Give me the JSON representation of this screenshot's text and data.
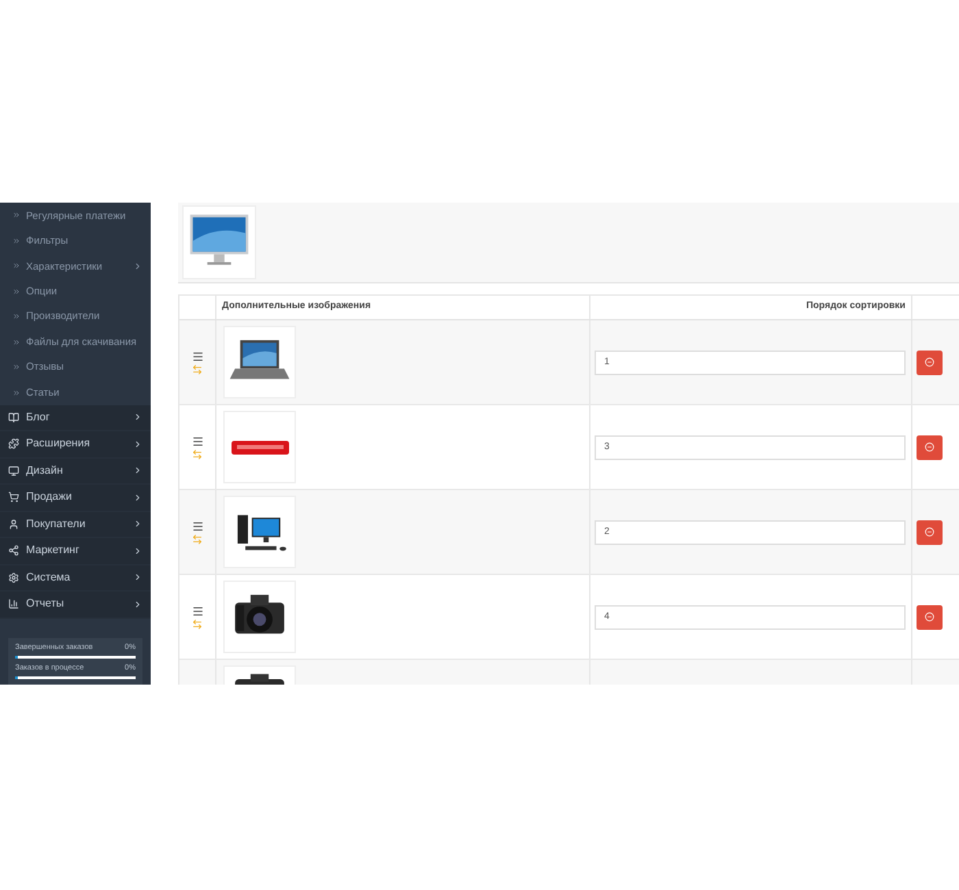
{
  "sidebar": {
    "sub_items": [
      {
        "label": "Регулярные платежи",
        "has_children": false
      },
      {
        "label": "Фильтры",
        "has_children": false
      },
      {
        "label": "Характеристики",
        "has_children": true
      },
      {
        "label": "Опции",
        "has_children": false
      },
      {
        "label": "Производители",
        "has_children": false
      },
      {
        "label": "Файлы для скачивания",
        "has_children": false
      },
      {
        "label": "Отзывы",
        "has_children": false
      },
      {
        "label": "Статьи",
        "has_children": false
      }
    ],
    "items": [
      {
        "label": "Блог"
      },
      {
        "label": "Расширения"
      },
      {
        "label": "Дизайн"
      },
      {
        "label": "Продажи"
      },
      {
        "label": "Покупатели"
      },
      {
        "label": "Маркетинг"
      },
      {
        "label": "Система"
      },
      {
        "label": "Отчеты"
      }
    ],
    "stats": [
      {
        "label": "Завершенных заказов",
        "value": "0%",
        "level": 0
      },
      {
        "label": "Заказов в процессе",
        "value": "0%",
        "level": 0
      }
    ]
  },
  "main_image": {
    "kind": "picture"
  },
  "table": {
    "columns": [
      "Дополнительные изображения",
      "Порядок сортировки"
    ],
    "rows": [
      {
        "kind": "picture",
        "sort_order": "1"
      },
      {
        "kind": "picture",
        "sort_order": "3"
      },
      {
        "kind": "picture",
        "sort_order": "2"
      },
      {
        "kind": "picture",
        "sort_order": "4"
      },
      {
        "kind": "picture"
      }
    ]
  }
}
